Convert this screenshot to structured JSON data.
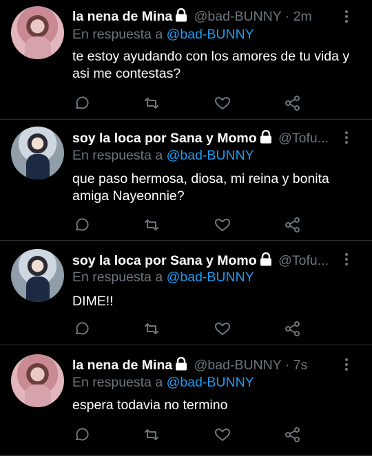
{
  "tweets": [
    {
      "name": "la nena de Mina",
      "handle": "@bad-BUNNY",
      "sep": "·",
      "time": "2m",
      "reply_label": "En respuesta a",
      "reply_to": "@bad-BUNNY",
      "text": "te estoy ayudando con los amores de tu vida y asi me contestas?",
      "avatar": "pink-portrait"
    },
    {
      "name": "soy la loca por Sana y Momo",
      "handle": "@Tofu...",
      "sep": "",
      "time": "",
      "reply_label": "En respuesta a",
      "reply_to": "@bad-BUNNY",
      "text": "que paso hermosa, diosa, mi reina y bonita amiga Nayeonnie?",
      "avatar": "hoodie-portrait"
    },
    {
      "name": "soy la loca por Sana y Momo",
      "handle": "@Tofu...",
      "sep": "",
      "time": "",
      "reply_label": "En respuesta a",
      "reply_to": "@bad-BUNNY",
      "text": "DIME!!",
      "avatar": "hoodie-portrait"
    },
    {
      "name": "la nena de Mina",
      "handle": "@bad-BUNNY",
      "sep": "·",
      "time": "7s",
      "reply_label": "En respuesta a",
      "reply_to": "@bad-BUNNY",
      "text": "espera todavia no termino",
      "avatar": "pink-portrait"
    }
  ],
  "icons": {
    "lock": "lock-icon",
    "more": "more-vertical-icon",
    "reply": "reply-icon",
    "retweet": "retweet-icon",
    "like": "heart-icon",
    "share": "share-icon"
  },
  "colors": {
    "background": "#000000",
    "text": "#ffffff",
    "muted": "#6e767d",
    "mention": "#1d9bf0",
    "divider": "#2f3336"
  }
}
